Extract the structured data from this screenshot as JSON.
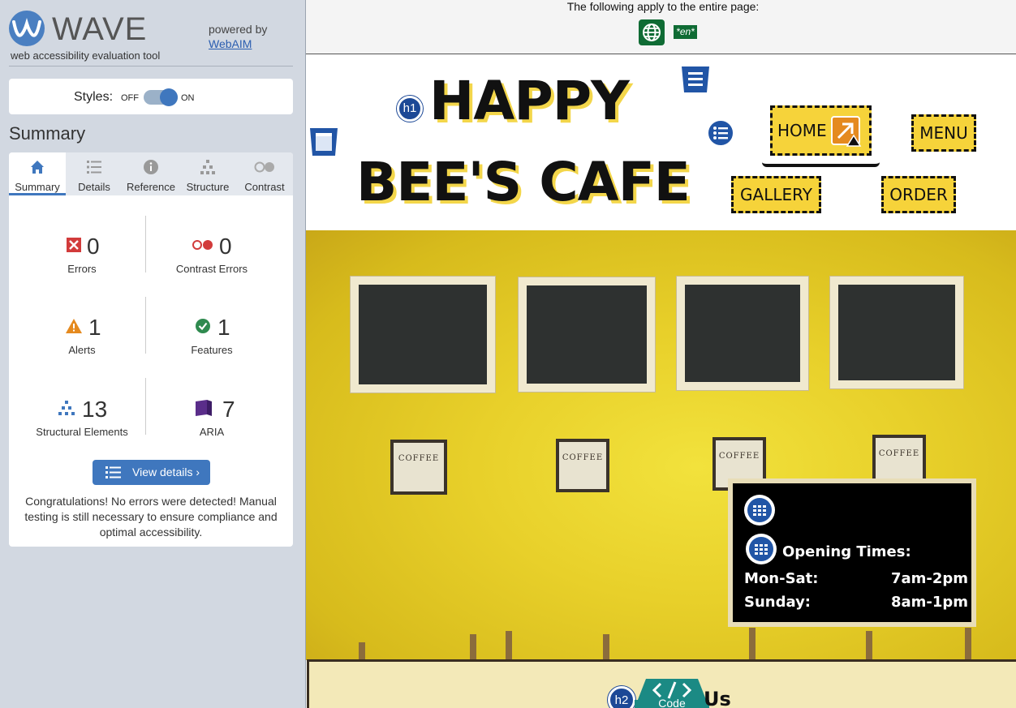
{
  "wave": {
    "title": "WAVE",
    "subtitle": "web accessibility evaluation tool",
    "powered_by": "powered by",
    "webaim_link": "WebAIM"
  },
  "styles": {
    "label": "Styles:",
    "off": "OFF",
    "on": "ON",
    "enabled": true
  },
  "summary_heading": "Summary",
  "tabs": [
    {
      "label": "Summary",
      "icon": "home-icon",
      "active": true
    },
    {
      "label": "Details",
      "icon": "list-icon",
      "active": false
    },
    {
      "label": "Reference",
      "icon": "info-icon",
      "active": false
    },
    {
      "label": "Structure",
      "icon": "hierarchy-icon",
      "active": false
    },
    {
      "label": "Contrast",
      "icon": "contrast-icon",
      "active": false
    }
  ],
  "stats": {
    "errors": {
      "count": "0",
      "label": "Errors",
      "color": "#d23b3b"
    },
    "contrast_errors": {
      "count": "0",
      "label": "Contrast Errors",
      "color": "#d23b3b"
    },
    "alerts": {
      "count": "1",
      "label": "Alerts",
      "color": "#e58a1f"
    },
    "features": {
      "count": "1",
      "label": "Features",
      "color": "#2f8a4f"
    },
    "structural": {
      "count": "13",
      "label": "Structural Elements",
      "color": "#3f77be"
    },
    "aria": {
      "count": "7",
      "label": "ARIA",
      "color": "#5a2d8a"
    }
  },
  "view_details_label": "View details ›",
  "congrats": "Congratulations! No errors were detected! Manual testing is still necessary to ensure compliance and optimal accessibility.",
  "page_notice": "The following apply to the entire page:",
  "lang_badge": "*en*",
  "site": {
    "title_line1": "HAPPY",
    "title_line2": "BEE'S CAFE",
    "h1_badge": "h1",
    "nav": [
      "HOME",
      "MENU",
      "GALLERY",
      "ORDER"
    ]
  },
  "opening": {
    "title": "Opening Times:",
    "rows": [
      {
        "day": "Mon-Sat:",
        "hours": "7am-2pm"
      },
      {
        "day": "Sunday:",
        "hours": "8am-1pm"
      }
    ]
  },
  "footer": {
    "h2_badge": "h2",
    "code_label": "Code",
    "heading_tail": "Us"
  },
  "sign_text": [
    "COFFEE",
    "COFFEE",
    "COFFEE",
    "COFFEE"
  ],
  "colors": {
    "wave_blue": "#3f77be",
    "nav_yellow": "#f6d33a",
    "feature_green": "#0f6b34"
  }
}
